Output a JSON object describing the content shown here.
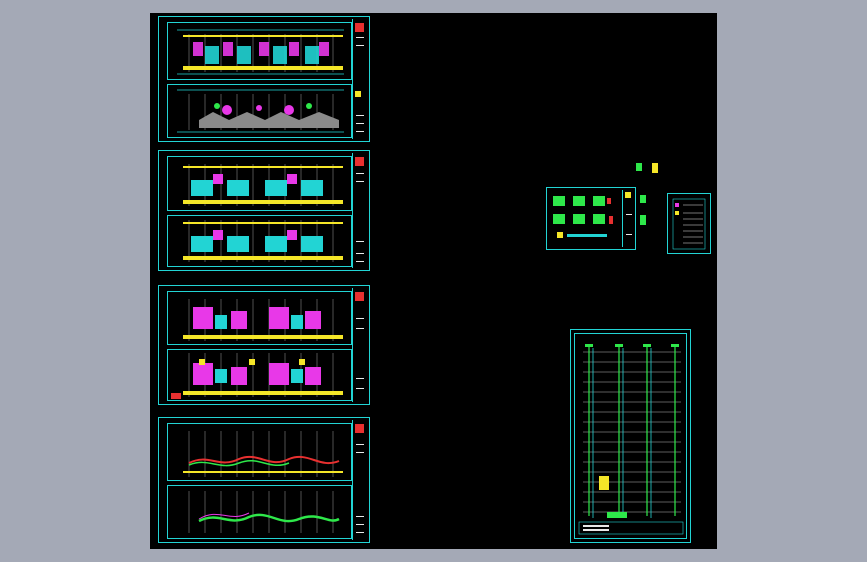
{
  "viewer": {
    "background_color": "#a4a9b6",
    "canvas_color": "#000000",
    "line_color": "#22d4d4",
    "accent_colors": [
      "#22d4d4",
      "#e838e8",
      "#f5e628",
      "#2ee84a",
      "#e83030",
      "#ffffff"
    ]
  },
  "sheets": {
    "floor_plan_sheets": [
      "sheet-1",
      "sheet-2",
      "sheet-3",
      "sheet-4"
    ],
    "detail_sheet": "sheet-details",
    "legend_sheet": "sheet-legend",
    "riser_diagram_sheet": "sheet-riser"
  }
}
